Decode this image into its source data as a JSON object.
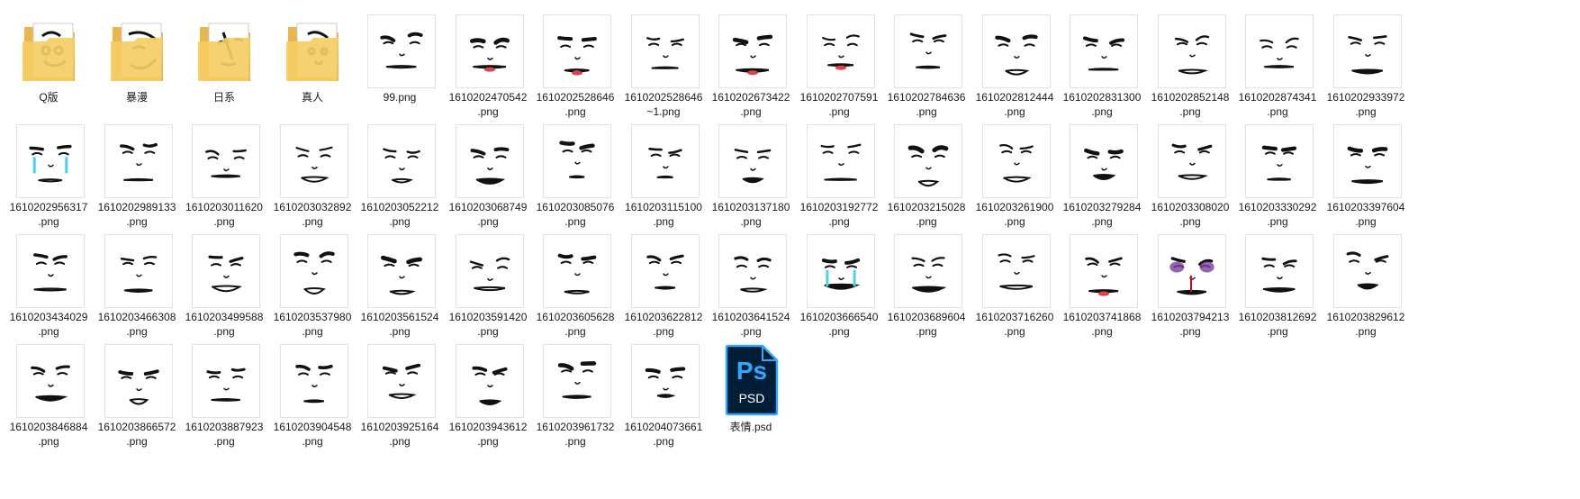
{
  "window": {
    "view": "large-icons"
  },
  "colors": {
    "folder_back": "#e8b64d",
    "folder_front": "#f5cd63",
    "ps_bg": "#001e36",
    "ps_blue": "#31a8ff",
    "psd_text": "#ffffff",
    "tear": "#4fd0f2",
    "lips": "#e0424b",
    "bruise": "#7a3fa0"
  },
  "files": [
    {
      "name": "Q版",
      "type": "folder"
    },
    {
      "name": "暴漫",
      "type": "folder"
    },
    {
      "name": "日系",
      "type": "folder"
    },
    {
      "name": "真人",
      "type": "folder"
    },
    {
      "name": "99.png",
      "type": "image"
    },
    {
      "name": "1610202470542\n.png",
      "type": "image",
      "accent": "lips"
    },
    {
      "name": "1610202528646\n.png",
      "type": "image",
      "accent": "lips"
    },
    {
      "name": "1610202528646\n~1.png",
      "type": "image"
    },
    {
      "name": "1610202673422\n.png",
      "type": "image",
      "accent": "lips"
    },
    {
      "name": "1610202707591\n.png",
      "type": "image",
      "accent": "lips"
    },
    {
      "name": "1610202784636\n.png",
      "type": "image"
    },
    {
      "name": "1610202812444\n.png",
      "type": "image"
    },
    {
      "name": "1610202831300\n.png",
      "type": "image"
    },
    {
      "name": "1610202852148\n.png",
      "type": "image"
    },
    {
      "name": "1610202874341\n.png",
      "type": "image"
    },
    {
      "name": "1610202933972\n.png",
      "type": "image"
    },
    {
      "name": "1610202956317\n.png",
      "type": "image",
      "accent": "tear"
    },
    {
      "name": "1610202989133\n.png",
      "type": "image"
    },
    {
      "name": "1610203011620\n.png",
      "type": "image"
    },
    {
      "name": "1610203032892\n.png",
      "type": "image"
    },
    {
      "name": "1610203052212\n.png",
      "type": "image"
    },
    {
      "name": "1610203068749\n.png",
      "type": "image"
    },
    {
      "name": "1610203085076\n.png",
      "type": "image"
    },
    {
      "name": "1610203115100\n.png",
      "type": "image"
    },
    {
      "name": "1610203137180\n.png",
      "type": "image"
    },
    {
      "name": "1610203192772\n.png",
      "type": "image"
    },
    {
      "name": "1610203215028\n.png",
      "type": "image"
    },
    {
      "name": "1610203261900\n.png",
      "type": "image"
    },
    {
      "name": "1610203279284\n.png",
      "type": "image"
    },
    {
      "name": "1610203308020\n.png",
      "type": "image"
    },
    {
      "name": "1610203330292\n.png",
      "type": "image"
    },
    {
      "name": "1610203397604\n.png",
      "type": "image"
    },
    {
      "name": "1610203434029\n.png",
      "type": "image"
    },
    {
      "name": "1610203466308\n.png",
      "type": "image"
    },
    {
      "name": "1610203499588\n.png",
      "type": "image"
    },
    {
      "name": "1610203537980\n.png",
      "type": "image"
    },
    {
      "name": "1610203561524\n.png",
      "type": "image"
    },
    {
      "name": "1610203591420\n.png",
      "type": "image"
    },
    {
      "name": "1610203605628\n.png",
      "type": "image"
    },
    {
      "name": "1610203622812\n.png",
      "type": "image"
    },
    {
      "name": "1610203641524\n.png",
      "type": "image"
    },
    {
      "name": "1610203666540\n.png",
      "type": "image",
      "accent": "tear"
    },
    {
      "name": "1610203689604\n.png",
      "type": "image"
    },
    {
      "name": "1610203716260\n.png",
      "type": "image"
    },
    {
      "name": "1610203741868\n.png",
      "type": "image",
      "accent": "lips"
    },
    {
      "name": "1610203794213\n.png",
      "type": "image",
      "accent": "bruise"
    },
    {
      "name": "1610203812692\n.png",
      "type": "image"
    },
    {
      "name": "1610203829612\n.png",
      "type": "image"
    },
    {
      "name": "1610203846884\n.png",
      "type": "image"
    },
    {
      "name": "1610203866572\n.png",
      "type": "image"
    },
    {
      "name": "1610203887923\n.png",
      "type": "image"
    },
    {
      "name": "1610203904548\n.png",
      "type": "image"
    },
    {
      "name": "1610203925164\n.png",
      "type": "image"
    },
    {
      "name": "1610203943612\n.png",
      "type": "image"
    },
    {
      "name": "1610203961732\n.png",
      "type": "image"
    },
    {
      "name": "1610204073661\n.png",
      "type": "image"
    },
    {
      "name": "表情.psd",
      "type": "psd",
      "icon_text": "Ps",
      "icon_sub": "PSD"
    }
  ]
}
